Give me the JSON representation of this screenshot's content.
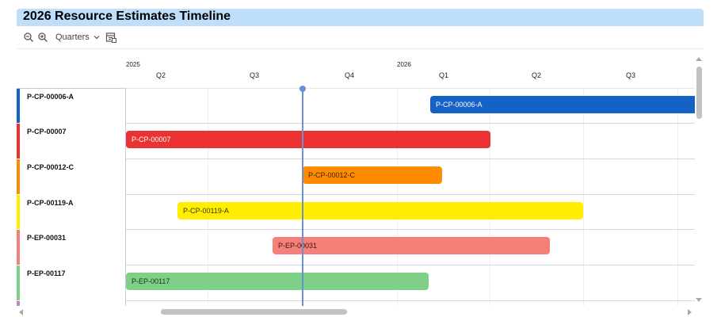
{
  "app": {
    "title": "2026 Resource Estimates Timeline"
  },
  "toolbar": {
    "zoom_out_icon": "zoom-out-icon",
    "zoom_in_icon": "zoom-in-icon",
    "scale_label": "Quarters",
    "scale_icon": "chevron-down-icon",
    "export_icon": "calendar-export-icon"
  },
  "timeline": {
    "years": [
      "2025",
      "2026"
    ],
    "quarters": [
      "Q2",
      "Q3",
      "Q4",
      "Q1",
      "Q2",
      "Q3"
    ]
  },
  "rows": [
    {
      "label": "P-CP-00006-A",
      "color": "#1462c6",
      "bar_label": "P-CP-00006-A",
      "bar_color": "#1462c6",
      "text_color": "#ffffff"
    },
    {
      "label": "P-CP-00007",
      "color": "#eb3232",
      "bar_label": "P-CP-00007",
      "bar_color": "#eb3232",
      "text_color": "#ffffff"
    },
    {
      "label": "P-CP-00012-C",
      "color": "#ff8c00",
      "bar_label": "P-CP-00012-C",
      "bar_color": "#ff8c00",
      "text_color": "#3b2200"
    },
    {
      "label": "P-CP-00119-A",
      "color": "#ffee00",
      "bar_label": "P-CP-00119-A",
      "bar_color": "#ffee00",
      "text_color": "#3b3500"
    },
    {
      "label": "P-EP-00031",
      "color": "#f77f7a",
      "bar_label": "P-EP-00031",
      "bar_color": "#f77f7a",
      "text_color": "#3d1414"
    },
    {
      "label": "P-EP-00117",
      "color": "#7dd085",
      "bar_label": "P-EP-00117",
      "bar_color": "#7dd085",
      "text_color": "#173a1a"
    }
  ]
}
